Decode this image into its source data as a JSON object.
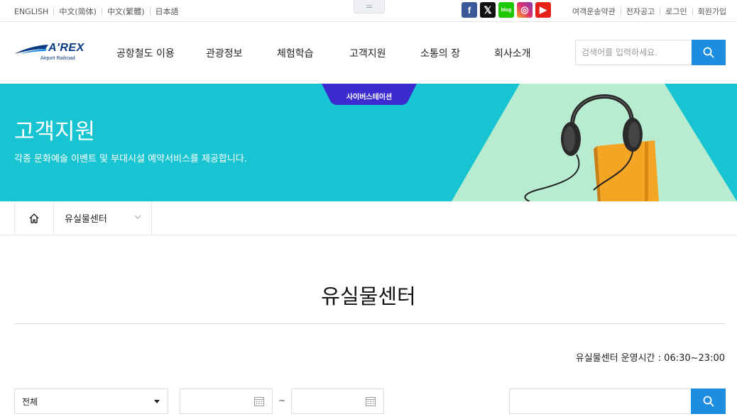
{
  "topbar": {
    "languages": [
      "ENGLISH",
      "中文(简体)",
      "中文(繁體)",
      "日本語"
    ],
    "menu_toggle_glyph": "=",
    "socials": {
      "facebook": "f",
      "x": "𝕏",
      "blog": "blog",
      "instagram": "◎",
      "youtube": "▶"
    },
    "links": [
      "여객운송약관",
      "전자공고",
      "로그인",
      "회원가입"
    ]
  },
  "logo": {
    "brand": "A'REX",
    "sub": "Airport Railroad"
  },
  "gnb": [
    "공항철도 이용",
    "관광정보",
    "체험학습",
    "고객지원",
    "소통의 장",
    "회사소개"
  ],
  "search": {
    "placeholder": "검색어를 입력하세요."
  },
  "banner": {
    "tab": "사이버스테이션",
    "title": "고객지원",
    "subtitle": "각종 문화예술 이벤트 및 부대시설 예약서비스를 제공합니다."
  },
  "breadcrumb": {
    "current": "유실물센터"
  },
  "page": {
    "title": "유실물센터",
    "hours": "유실물센터 운영시간 : 06:30~23:00"
  },
  "filter": {
    "category_selected": "전체",
    "range_separator": "~"
  },
  "colors": {
    "accent_blue": "#1c8de0",
    "banner_teal": "#19c4d2",
    "tab_purple": "#3c2bd1",
    "logo_navy": "#0a3b82"
  }
}
